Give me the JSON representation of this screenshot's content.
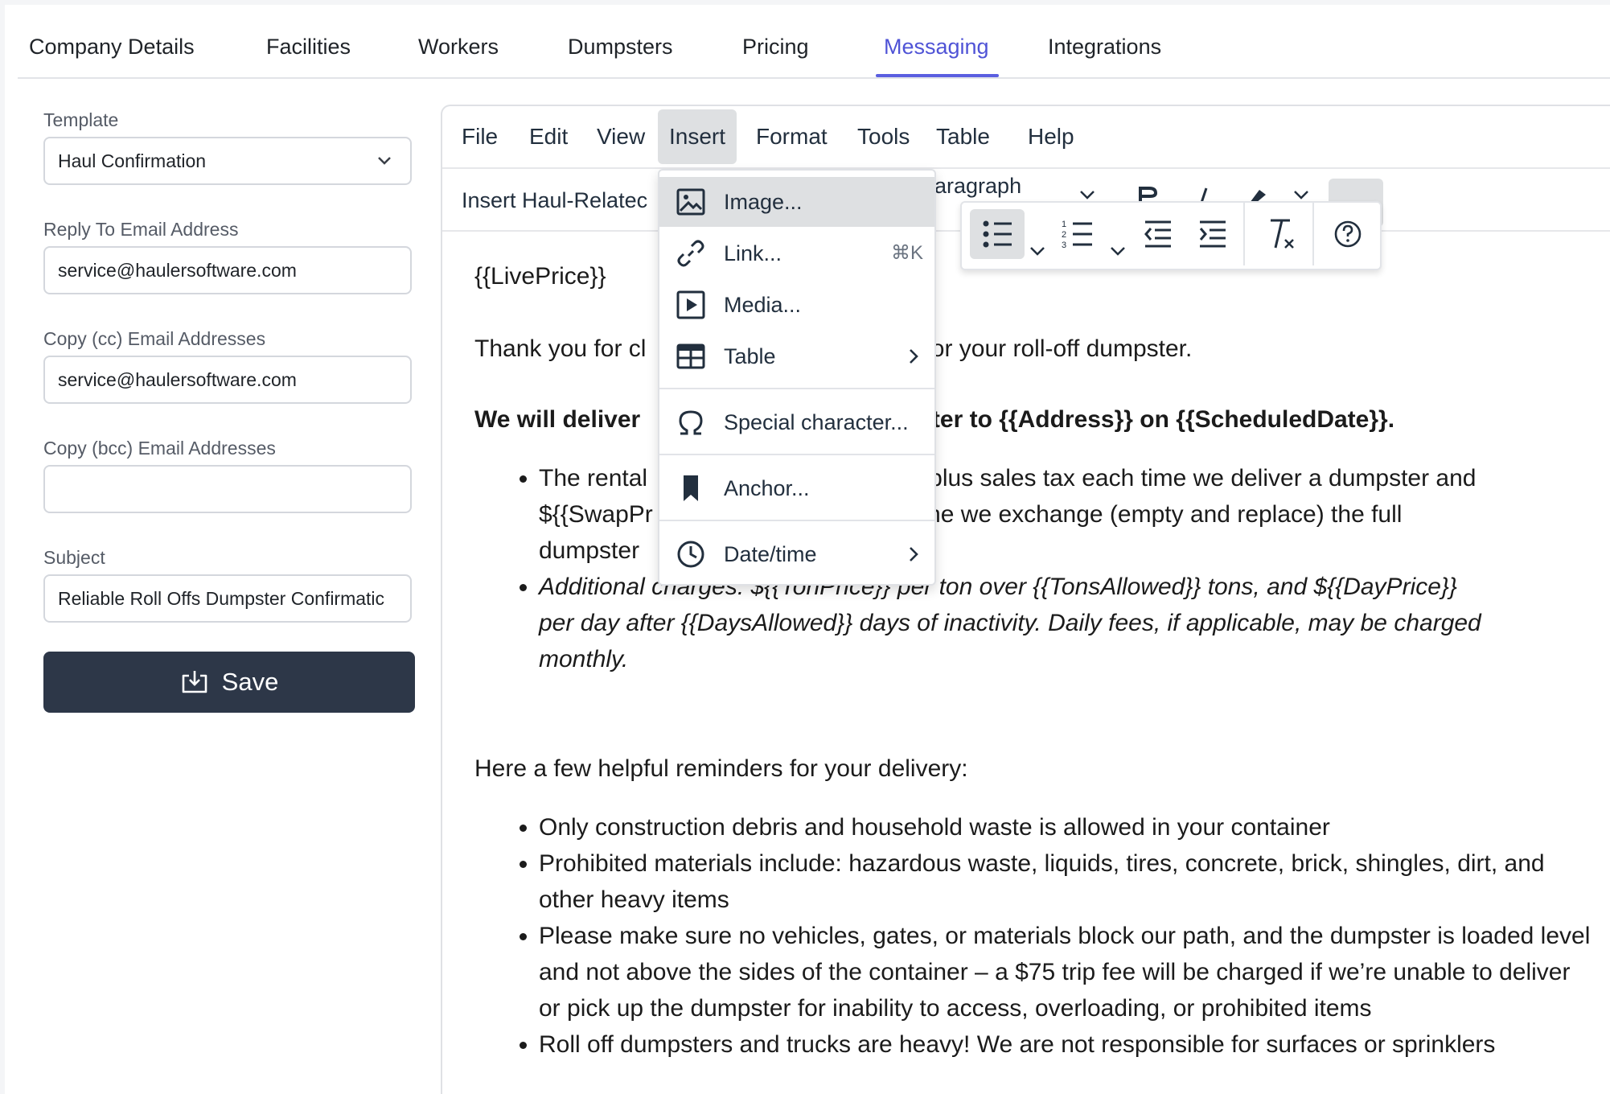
{
  "tabs": [
    "Company Details",
    "Facilities",
    "Workers",
    "Dumpsters",
    "Pricing",
    "Messaging",
    "Integrations"
  ],
  "active_tab": "Messaging",
  "form": {
    "template_label": "Template",
    "template_value": "Haul Confirmation",
    "reply_label": "Reply To Email Address",
    "reply_value": "service@haulersoftware.com",
    "cc_label": "Copy (cc) Email Addresses",
    "cc_value": "service@haulersoftware.com",
    "bcc_label": "Copy (bcc) Email Addresses",
    "bcc_value": "",
    "subject_label": "Subject",
    "subject_value": "Reliable Roll Offs Dumpster Confirmatic",
    "save_label": "Save"
  },
  "editor": {
    "menu": [
      "File",
      "Edit",
      "View",
      "Insert",
      "Format",
      "Tools",
      "Table",
      "Help"
    ],
    "insert_dropdown_label": "Insert Haul-Relatec",
    "format_select_partial": "aragraph",
    "dropdown": {
      "image": "Image...",
      "link": "Link...",
      "link_shortcut": "⌘K",
      "media": "Media...",
      "table": "Table",
      "special": "Special character...",
      "anchor": "Anchor...",
      "datetime": "Date/time"
    },
    "content": {
      "line1": "{{LivePrice}}",
      "line2_a": "Thank you for cl",
      "line2_b": "for your roll-off dumpster.",
      "line3_a": "We will deliver",
      "line3_b": "ster to {{Address}} on {{ScheduledDate}}.",
      "b1_l1_a": "The rental",
      "b1_l1_b": "ce}} plus sales tax each time we deliver a dumpster and",
      "b1_l2_a": "${{SwapPr",
      "b1_l2_b": "time we exchange (empty and replace) the full",
      "b1_l3": "dumpster",
      "b2_l1": "Additional charges: ${{TonPrice}} per ton over {{TonsAllowed}} tons, and ${{DayPrice}}",
      "b2_l2": "per day after {{DaysAllowed}} days of inactivity. Daily fees, if applicable, may be charged",
      "b2_l3": "monthly.",
      "reminders_title": "Here a few helpful reminders for your delivery:",
      "r1": "Only construction debris and household waste is allowed in your container",
      "r2": "Prohibited materials include: hazardous waste, liquids, tires, concrete, brick, shingles, dirt, and other heavy items",
      "r3": "Please make sure no vehicles, gates, or materials block our  path, and the dumpster is loaded level and not above the sides of the container – a $75 trip fee will be charged if we’re unable to deliver or pick up the dumpster for inability to access, overloading, or prohibited items",
      "r4": "Roll off dumpsters and trucks are heavy! We are not responsible for surfaces or sprinklers"
    }
  },
  "colors": {
    "accent": "#4f53d6",
    "save_bg": "#2d3748",
    "menu_active_bg": "#dee0e2"
  }
}
